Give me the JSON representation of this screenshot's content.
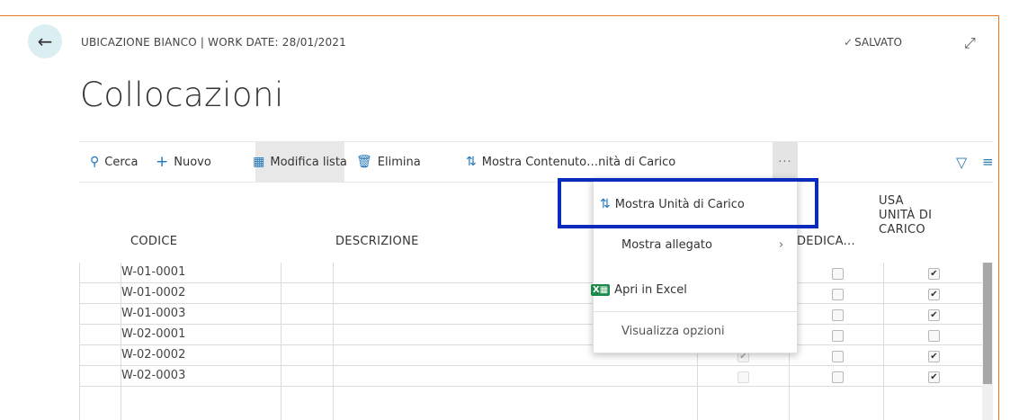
{
  "header": {
    "breadcrumb": "UBICAZIONE BIANCO | WORK DATE: 28/01/2021",
    "saved_label": "SALVATO",
    "title": "Collocazioni"
  },
  "toolbar": {
    "search": "Cerca",
    "new": "Nuovo",
    "edit_list": "Modifica lista",
    "delete": "Elimina",
    "show_content": "Mostra Contenuto…nità di Carico",
    "more": "···"
  },
  "columns": {
    "code": "CODICE",
    "description": "DESCRIZIONE",
    "dedicated": "DEDICA...",
    "use_unit_line1": "USA",
    "use_unit_line2": "UNITÀ DI",
    "use_unit_line3": "CARICO"
  },
  "rows": [
    {
      "code": "W-01-0001",
      "c1": false,
      "c2": false,
      "c3": true
    },
    {
      "code": "W-01-0002",
      "c1": false,
      "c2": false,
      "c3": true
    },
    {
      "code": "W-01-0003",
      "c1": false,
      "c2": false,
      "c3": true
    },
    {
      "code": "W-02-0001",
      "c1": false,
      "c2": false,
      "c3": false
    },
    {
      "code": "W-02-0002",
      "c1": true,
      "c2": false,
      "c3": true
    },
    {
      "code": "W-02-0003",
      "c1": false,
      "c2": false,
      "c3": true
    }
  ],
  "menu": {
    "show_units": "Mostra Unità di Carico",
    "show_attachment": "Mostra allegato",
    "open_excel": "Apri in Excel",
    "view_options": "Visualizza opzioni"
  },
  "colors": {
    "accent_border": "#e87722",
    "highlight": "#0a2bbd",
    "back_button_bg": "#dbeff2"
  }
}
